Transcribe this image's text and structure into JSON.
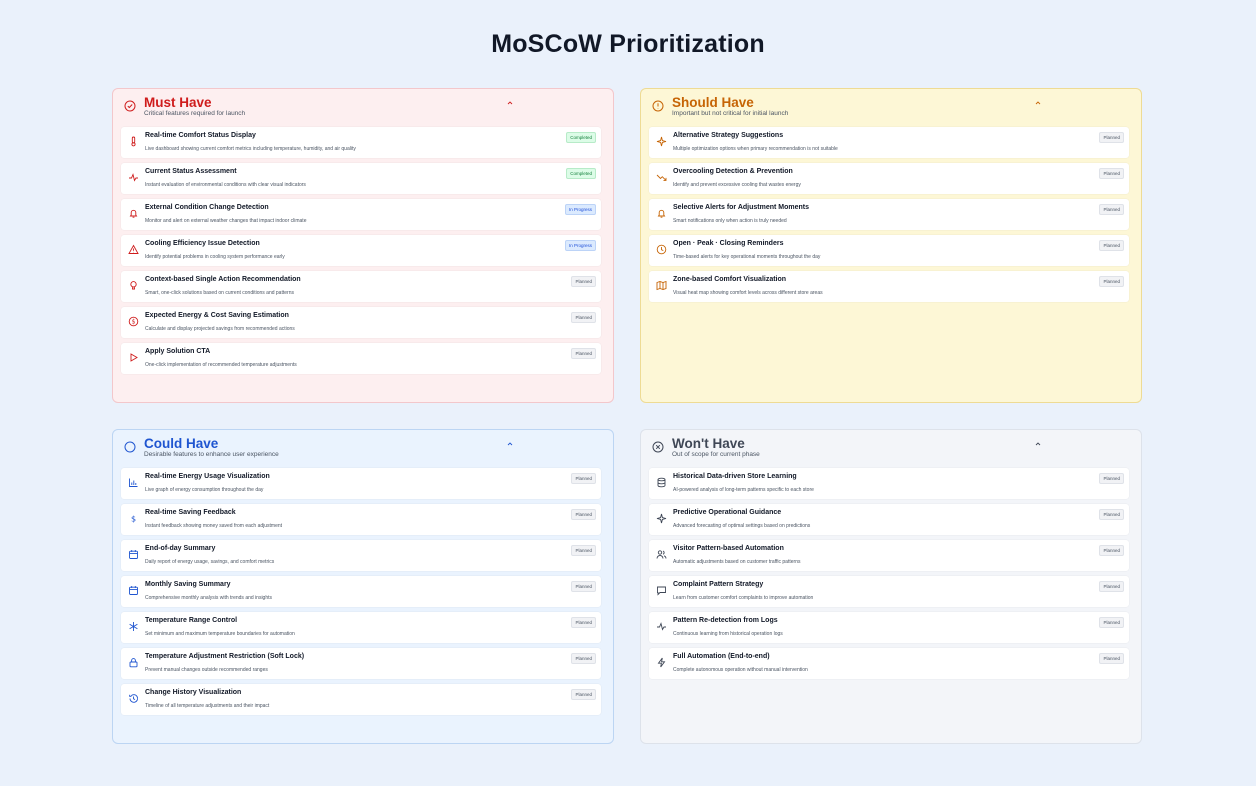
{
  "page": {
    "title": "MoSCoW Prioritization"
  },
  "colors": {
    "must": "#cf1c1c",
    "should": "#c66405",
    "could": "#1f55d0",
    "wont": "#3f4756",
    "completed_badge": "#15803d",
    "in_progress_badge": "#1d4ed8"
  },
  "must": {
    "title": "Must Have",
    "subtitle": "Critical features required for launch",
    "icon": "check-circle-icon",
    "items": [
      {
        "title": "Real-time Comfort Status Display",
        "desc": "Live dashboard showing current comfort metrics including temperature, humidity, and air quality",
        "status": "Completed",
        "icon": "thermometer-icon"
      },
      {
        "title": "Current Status Assessment",
        "desc": "Instant evaluation of environmental conditions with clear visual indicators",
        "status": "Completed",
        "icon": "activity-icon"
      },
      {
        "title": "External Condition Change Detection",
        "desc": "Monitor and alert on external weather changes that impact indoor climate",
        "status": "In Progress",
        "icon": "bell-icon"
      },
      {
        "title": "Cooling Efficiency Issue Detection",
        "desc": "Identify potential problems in cooling system performance early",
        "status": "In Progress",
        "icon": "alert-triangle-icon"
      },
      {
        "title": "Context-based Single Action Recommendation",
        "desc": "Smart, one-click solutions based on current conditions and patterns",
        "status": "Planned",
        "icon": "lightbulb-icon"
      },
      {
        "title": "Expected Energy & Cost Saving Estimation",
        "desc": "Calculate and display projected savings from recommended actions",
        "status": "Planned",
        "icon": "dollar-circle-icon"
      },
      {
        "title": "Apply Solution CTA",
        "desc": "One-click implementation of recommended temperature adjustments",
        "status": "Planned",
        "icon": "play-icon"
      }
    ]
  },
  "should": {
    "title": "Should Have",
    "subtitle": "Important but not critical for initial launch",
    "icon": "alert-circle-icon",
    "items": [
      {
        "title": "Alternative Strategy Suggestions",
        "desc": "Multiple optimization options when primary recommendation is not suitable",
        "status": "Planned",
        "icon": "sparkles-icon"
      },
      {
        "title": "Overcooling Detection & Prevention",
        "desc": "Identify and prevent excessive cooling that wastes energy",
        "status": "Planned",
        "icon": "trending-down-icon"
      },
      {
        "title": "Selective Alerts for Adjustment Moments",
        "desc": "Smart notifications only when action is truly needed",
        "status": "Planned",
        "icon": "bell-icon"
      },
      {
        "title": "Open · Peak · Closing Reminders",
        "desc": "Time-based alerts for key operational moments throughout the day",
        "status": "Planned",
        "icon": "clock-icon"
      },
      {
        "title": "Zone-based Comfort Visualization",
        "desc": "Visual heat map showing comfort levels across different store areas",
        "status": "Planned",
        "icon": "map-icon"
      }
    ]
  },
  "could": {
    "title": "Could Have",
    "subtitle": "Desirable features to enhance user experience",
    "icon": "circle-icon",
    "items": [
      {
        "title": "Real-time Energy Usage Visualization",
        "desc": "Live graph of energy consumption throughout the day",
        "status": "Planned",
        "icon": "bar-chart-icon"
      },
      {
        "title": "Real-time Saving Feedback",
        "desc": "Instant feedback showing money saved from each adjustment",
        "status": "Planned",
        "icon": "dollar-icon"
      },
      {
        "title": "End-of-day Summary",
        "desc": "Daily report of energy usage, savings, and comfort metrics",
        "status": "Planned",
        "icon": "calendar-icon"
      },
      {
        "title": "Monthly Saving Summary",
        "desc": "Comprehensive monthly analysis with trends and insights",
        "status": "Planned",
        "icon": "calendar-icon"
      },
      {
        "title": "Temperature Range Control",
        "desc": "Set minimum and maximum temperature boundaries for automation",
        "status": "Planned",
        "icon": "snowflake-icon"
      },
      {
        "title": "Temperature Adjustment Restriction (Soft Lock)",
        "desc": "Prevent manual changes outside recommended ranges",
        "status": "Planned",
        "icon": "lock-icon"
      },
      {
        "title": "Change History Visualization",
        "desc": "Timeline of all temperature adjustments and their impact",
        "status": "Planned",
        "icon": "history-icon"
      }
    ]
  },
  "wont": {
    "title": "Won't Have",
    "subtitle": "Out of scope for current phase",
    "icon": "x-circle-icon",
    "items": [
      {
        "title": "Historical Data-driven Store Learning",
        "desc": "AI-powered analysis of long-term patterns specific to each store",
        "status": "Planned",
        "icon": "database-icon"
      },
      {
        "title": "Predictive Operational Guidance",
        "desc": "Advanced forecasting of optimal settings based on predictions",
        "status": "Planned",
        "icon": "sparkles-icon"
      },
      {
        "title": "Visitor Pattern-based Automation",
        "desc": "Automatic adjustments based on customer traffic patterns",
        "status": "Planned",
        "icon": "users-icon"
      },
      {
        "title": "Complaint Pattern Strategy",
        "desc": "Learn from customer comfort complaints to improve automation",
        "status": "Planned",
        "icon": "message-icon"
      },
      {
        "title": "Pattern Re-detection from Logs",
        "desc": "Continuous learning from historical operation logs",
        "status": "Planned",
        "icon": "activity-icon"
      },
      {
        "title": "Full Automation (End-to-end)",
        "desc": "Complete autonomous operation without manual intervention",
        "status": "Planned",
        "icon": "zap-icon"
      }
    ]
  }
}
